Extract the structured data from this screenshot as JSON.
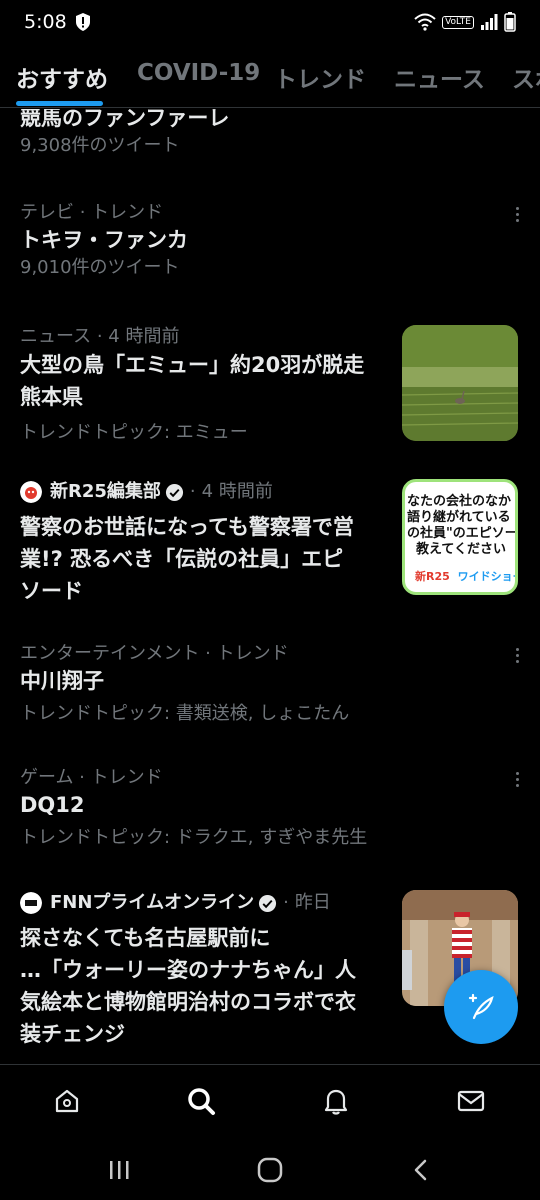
{
  "status": {
    "time": "5:08",
    "network_badge": "VoLTE",
    "icons": [
      "shield-alert-icon",
      "wifi-icon",
      "signal-icon",
      "battery-icon"
    ]
  },
  "tabs": [
    "おすすめ",
    "COVID-19",
    "トレンド",
    "ニュース",
    "スポ"
  ],
  "active_tab": 0,
  "feed": {
    "item0": {
      "title": "競馬のファンファーレ",
      "count": "9,308件のツイート"
    },
    "item1": {
      "context": "テレビ · トレンド",
      "title": "トキヲ・ファンカ",
      "count": "9,010件のツイート"
    },
    "item2": {
      "context": "ニュース · 4 時間前",
      "title_lines": [
        "大型の鳥「エミュー」約20羽が脱走",
        "熊本県"
      ],
      "topic": "トレンドトピック: エミュー"
    },
    "item3": {
      "source": "新R25編集部",
      "dot": "·",
      "ago": "4 時間前",
      "title_lines": [
        "警察のお世話になっても警察署で営",
        "業!? 恐るべき「伝説の社員」エピ",
        "ソード"
      ],
      "thumb_lines": [
        "なたの会社のなか",
        "語り継がれている",
        "の社員\"のエピソー",
        "教えてください"
      ],
      "thumb_brand": "新R25",
      "thumb_sub": "ワイドショー"
    },
    "item4": {
      "context": "エンターテインメント · トレンド",
      "title": "中川翔子",
      "topic": "トレンドトピック: 書類送検, しょこたん"
    },
    "item5": {
      "context": "ゲーム · トレンド",
      "title": "DQ12",
      "topic": "トレンドトピック: ドラクエ, すぎやま先生"
    },
    "item6": {
      "source": "FNNプライムオンライン",
      "dot": "·",
      "ago": "昨日",
      "title_lines": [
        "探さなくても名古屋駅前に",
        "…「ウォーリー姿のナナちゃん」人",
        "気絵本と博物館明治村のコラボで衣",
        "装チェンジ"
      ]
    }
  },
  "colors": {
    "accent": "#1d9bf0",
    "background": "#000000",
    "text": "#e7e9ea",
    "muted": "#71767b",
    "divider": "#2f3336"
  },
  "bottom_nav": [
    "home-icon",
    "search-icon",
    "notifications-icon",
    "messages-icon"
  ],
  "system_nav": [
    "recents-icon",
    "home-circle-icon",
    "back-icon"
  ]
}
